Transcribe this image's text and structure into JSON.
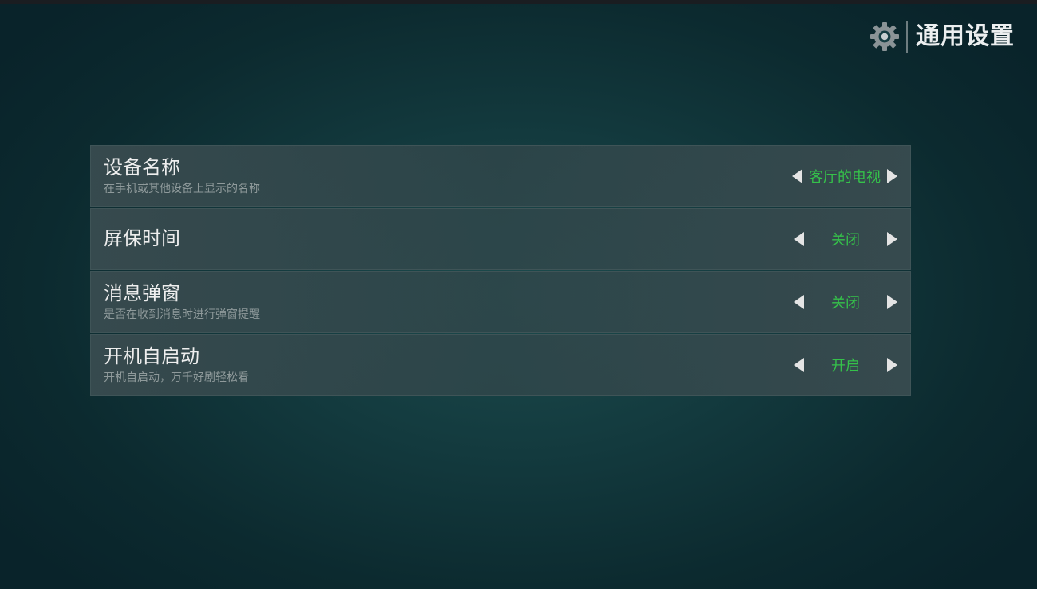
{
  "header": {
    "icon": "gear-icon",
    "title": "通用设置"
  },
  "colors": {
    "accent": "#35c24a",
    "row_background": "#3a4c50",
    "page_background": "#123a3e"
  },
  "settings": [
    {
      "label": "设备名称",
      "description": "在手机或其他设备上显示的名称",
      "value": "客厅的电视"
    },
    {
      "label": "屏保时间",
      "description": "",
      "value": "关闭"
    },
    {
      "label": "消息弹窗",
      "description": "是否在收到消息时进行弹窗提醒",
      "value": "关闭"
    },
    {
      "label": "开机自启动",
      "description": "开机自启动，万千好剧轻松看",
      "value": "开启"
    }
  ]
}
